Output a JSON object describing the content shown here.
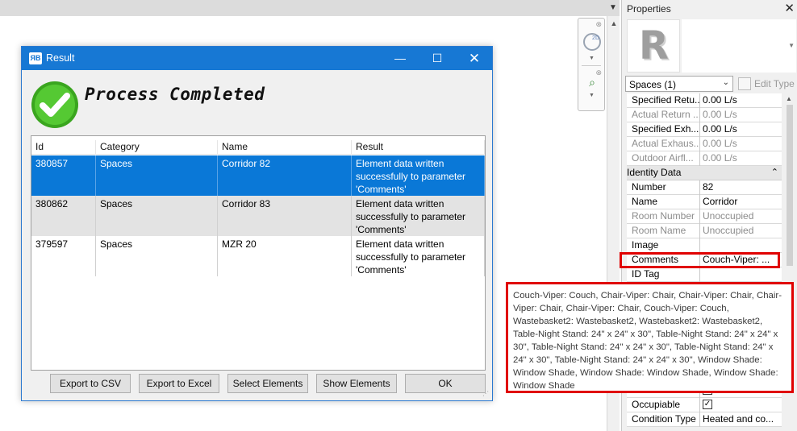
{
  "dialog": {
    "title": "Result",
    "app_icon_text": "ЯB",
    "heading": "Process Completed",
    "icons": {
      "status": "check-circle-icon",
      "minimize": "minimize-icon",
      "maximize": "maximize-icon",
      "close": "close-icon"
    },
    "colors": {
      "titlebar": "#1778d4",
      "selection": "#0a78d7",
      "success": "#4cc02a"
    },
    "table": {
      "columns": [
        "Id",
        "Category",
        "Name",
        "Result"
      ],
      "rows": [
        {
          "id": "380857",
          "category": "Spaces",
          "name": "Corridor 82",
          "result": "Element data written successfully to parameter 'Comments'",
          "selected": true
        },
        {
          "id": "380862",
          "category": "Spaces",
          "name": "Corridor 83",
          "result": "Element data written successfully to parameter 'Comments'",
          "selected": false
        },
        {
          "id": "379597",
          "category": "Spaces",
          "name": "MZR 20",
          "result": "Element data written successfully to parameter 'Comments'",
          "selected": false
        }
      ]
    },
    "buttons": {
      "export_csv": "Export to CSV",
      "export_excel": "Export to Excel",
      "select_elements": "Select Elements",
      "show_elements": "Show Elements",
      "ok": "OK"
    }
  },
  "properties": {
    "title": "Properties",
    "logo_letter": "R",
    "type_selector": "Spaces (1)",
    "edit_type": "Edit Type",
    "rows_top": [
      {
        "key": "Specified Retu...",
        "value": "0.00 L/s",
        "disabled": false
      },
      {
        "key": "Actual Return ...",
        "value": "0.00 L/s",
        "disabled": true
      },
      {
        "key": "Specified Exh...",
        "value": "0.00 L/s",
        "disabled": false
      },
      {
        "key": "Actual Exhaus...",
        "value": "0.00 L/s",
        "disabled": true
      },
      {
        "key": "Outdoor Airfl...",
        "value": "0.00 L/s",
        "disabled": true
      }
    ],
    "group_identity": "Identity Data",
    "rows_identity": [
      {
        "key": "Number",
        "value": "82",
        "disabled": false
      },
      {
        "key": "Name",
        "value": "Corridor",
        "disabled": false
      },
      {
        "key": "Room Number",
        "value": "Unoccupied",
        "disabled": true
      },
      {
        "key": "Room Name",
        "value": "Unoccupied",
        "disabled": true
      },
      {
        "key": "Image",
        "value": "",
        "disabled": false
      },
      {
        "key": "Comments",
        "value": "Couch-Viper: ...",
        "disabled": false
      },
      {
        "key": "ID Tag",
        "value": "",
        "disabled": false
      }
    ],
    "rows_bottom": [
      {
        "key": "Occupiable",
        "checked": true
      },
      {
        "key": "Condition Type",
        "value": "Heated and co..."
      }
    ]
  },
  "tooltip": {
    "text": "Couch-Viper: Couch, Chair-Viper: Chair, Chair-Viper: Chair, Chair-Viper: Chair, Chair-Viper: Chair, Couch-Viper: Couch, Wastebasket2: Wastebasket2, Wastebasket2: Wastebasket2, Table-Night Stand: 24\" x 24\" x 30\", Table-Night Stand: 24\" x 24\" x 30\", Table-Night Stand: 24\" x 24\" x 30\", Table-Night Stand: 24\" x 24\" x 30\", Table-Night Stand: 24\" x 24\" x 30\", Window Shade: Window Shade, Window Shade: Window Shade, Window Shade: Window Shade"
  },
  "navbar": {
    "icons": [
      "steering-wheel-2d-icon",
      "zoom-region-icon"
    ],
    "label_2d": "2D"
  }
}
